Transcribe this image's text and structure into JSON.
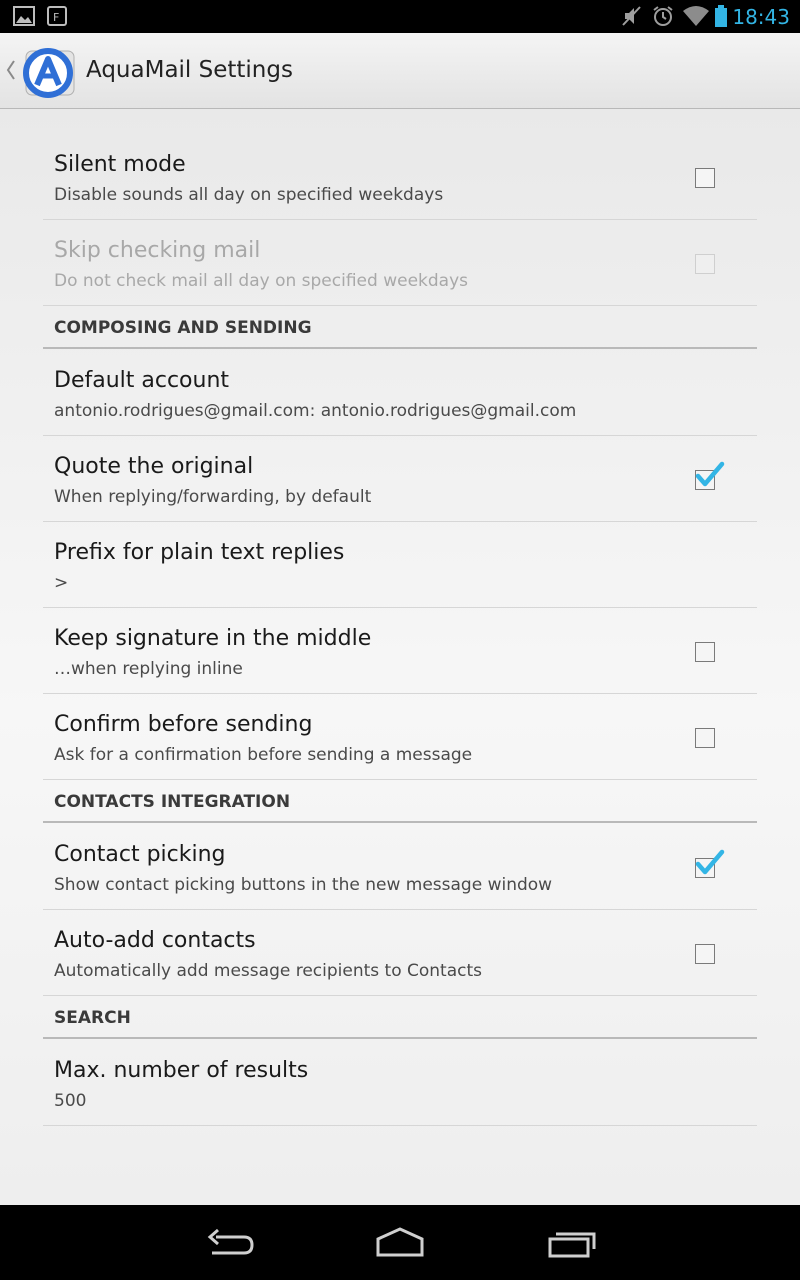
{
  "status_bar": {
    "time": "18:43",
    "left_icons": [
      "gallery-icon",
      "flipboard-icon"
    ],
    "right_icons": [
      "mute-icon",
      "alarm-icon",
      "wifi-icon",
      "battery-icon"
    ],
    "accent": "#33b5e5"
  },
  "action_bar": {
    "title": "AquaMail Settings",
    "logo_icon": "aquamail-logo-icon",
    "up_icon": "up-caret-icon"
  },
  "preferences": [
    {
      "kind": "item",
      "id": "silent-mode",
      "title": "Silent mode",
      "summary": "Disable sounds all day on specified weekdays",
      "checkbox": true,
      "checked": false,
      "enabled": true
    },
    {
      "kind": "item",
      "id": "skip-checking-mail",
      "title": "Skip checking mail",
      "summary": "Do not check mail all day on specified weekdays",
      "checkbox": true,
      "checked": false,
      "enabled": false
    },
    {
      "kind": "header",
      "id": "composing-and-sending",
      "title": "COMPOSING AND SENDING"
    },
    {
      "kind": "item",
      "id": "default-account",
      "title": "Default account",
      "summary": "antonio.rodrigues@gmail.com: antonio.rodrigues@gmail.com",
      "checkbox": false,
      "enabled": true
    },
    {
      "kind": "item",
      "id": "quote-the-original",
      "title": "Quote the original",
      "summary": "When replying/forwarding, by default",
      "checkbox": true,
      "checked": true,
      "enabled": true
    },
    {
      "kind": "item",
      "id": "prefix-plain-text",
      "title": "Prefix for plain text replies",
      "summary": ">",
      "checkbox": false,
      "enabled": true
    },
    {
      "kind": "item",
      "id": "keep-signature-middle",
      "title": "Keep signature in the middle",
      "summary": "…when replying inline",
      "checkbox": true,
      "checked": false,
      "enabled": true
    },
    {
      "kind": "item",
      "id": "confirm-before-sending",
      "title": "Confirm before sending",
      "summary": "Ask for a confirmation before sending a message",
      "checkbox": true,
      "checked": false,
      "enabled": true
    },
    {
      "kind": "header",
      "id": "contacts-integration",
      "title": "CONTACTS INTEGRATION"
    },
    {
      "kind": "item",
      "id": "contact-picking",
      "title": "Contact picking",
      "summary": "Show contact picking buttons in the new message window",
      "checkbox": true,
      "checked": true,
      "enabled": true
    },
    {
      "kind": "item",
      "id": "auto-add-contacts",
      "title": "Auto-add contacts",
      "summary": "Automatically add message recipients to Contacts",
      "checkbox": true,
      "checked": false,
      "enabled": true
    },
    {
      "kind": "header",
      "id": "search",
      "title": "SEARCH"
    },
    {
      "kind": "item",
      "id": "max-number-results",
      "title": "Max. number of results",
      "summary": "500",
      "checkbox": false,
      "enabled": true
    }
  ],
  "nav_bar": {
    "buttons": [
      "back-icon",
      "home-icon",
      "recent-apps-icon"
    ]
  },
  "colors": {
    "check_accent": "#33b5e5"
  }
}
